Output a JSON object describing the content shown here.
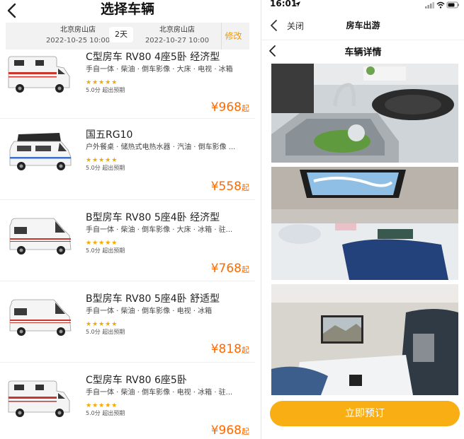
{
  "left": {
    "title": "选择车辆",
    "pickup": {
      "store": "北京房山店",
      "time": "2022-10-25 10:00"
    },
    "return": {
      "store": "北京房山店",
      "time": "2022-10-27 10:00"
    },
    "days": "2天",
    "modify_label": "修改",
    "cars": [
      {
        "name": "C型房车 RV80 4座5卧 经济型",
        "features": "手自一体 · 柴油 · 倒车影像 · 大床 · 电视 · 冰箱",
        "stars": "★★★★★",
        "score": "5.0分 超出预期",
        "price": "¥968",
        "unit": "起"
      },
      {
        "name": "国五RG10",
        "features": "户外餐桌 · 储热式电热水器 · 汽油 · 倒车影像 ...",
        "stars": "★★★★★",
        "score": "5.0分 超出预期",
        "price": "¥558",
        "unit": "起"
      },
      {
        "name": "B型房车 RV80 5座4卧 经济型",
        "features": "手自一体 · 柴油 · 倒车影像 · 大床 · 冰箱 · 驻...",
        "stars": "★★★★★",
        "score": "5.0分 超出预期",
        "price": "¥768",
        "unit": "起"
      },
      {
        "name": "B型房车 RV80 5座4卧 舒适型",
        "features": "手自一体 · 柴油 · 倒车影像 · 电视 · 冰箱",
        "stars": "★★★★★",
        "score": "5.0分 超出预期",
        "price": "¥818",
        "unit": "起"
      },
      {
        "name": "C型房车 RV80 6座5卧",
        "features": "手自一体 · 柴油 · 倒车影像 · 电视 · 冰箱 · 驻...",
        "stars": "★★★★★",
        "score": "5.0分 超出预期",
        "price": "¥968",
        "unit": "起"
      }
    ]
  },
  "right": {
    "status_time": "16:01",
    "close_label": "关闭",
    "web_title": "房车出游",
    "page_title": "车辆详情",
    "book_label": "立即预订"
  },
  "colors": {
    "accent_orange": "#f39a00",
    "price_orange": "#ff6a00",
    "star_yellow": "#f5a800",
    "button_yellow": "#f9ae14"
  },
  "icons": {
    "back": "chevron-left-icon",
    "signal": "signal-icon",
    "wifi": "wifi-icon",
    "battery": "battery-icon",
    "location": "location-arrow-icon"
  }
}
